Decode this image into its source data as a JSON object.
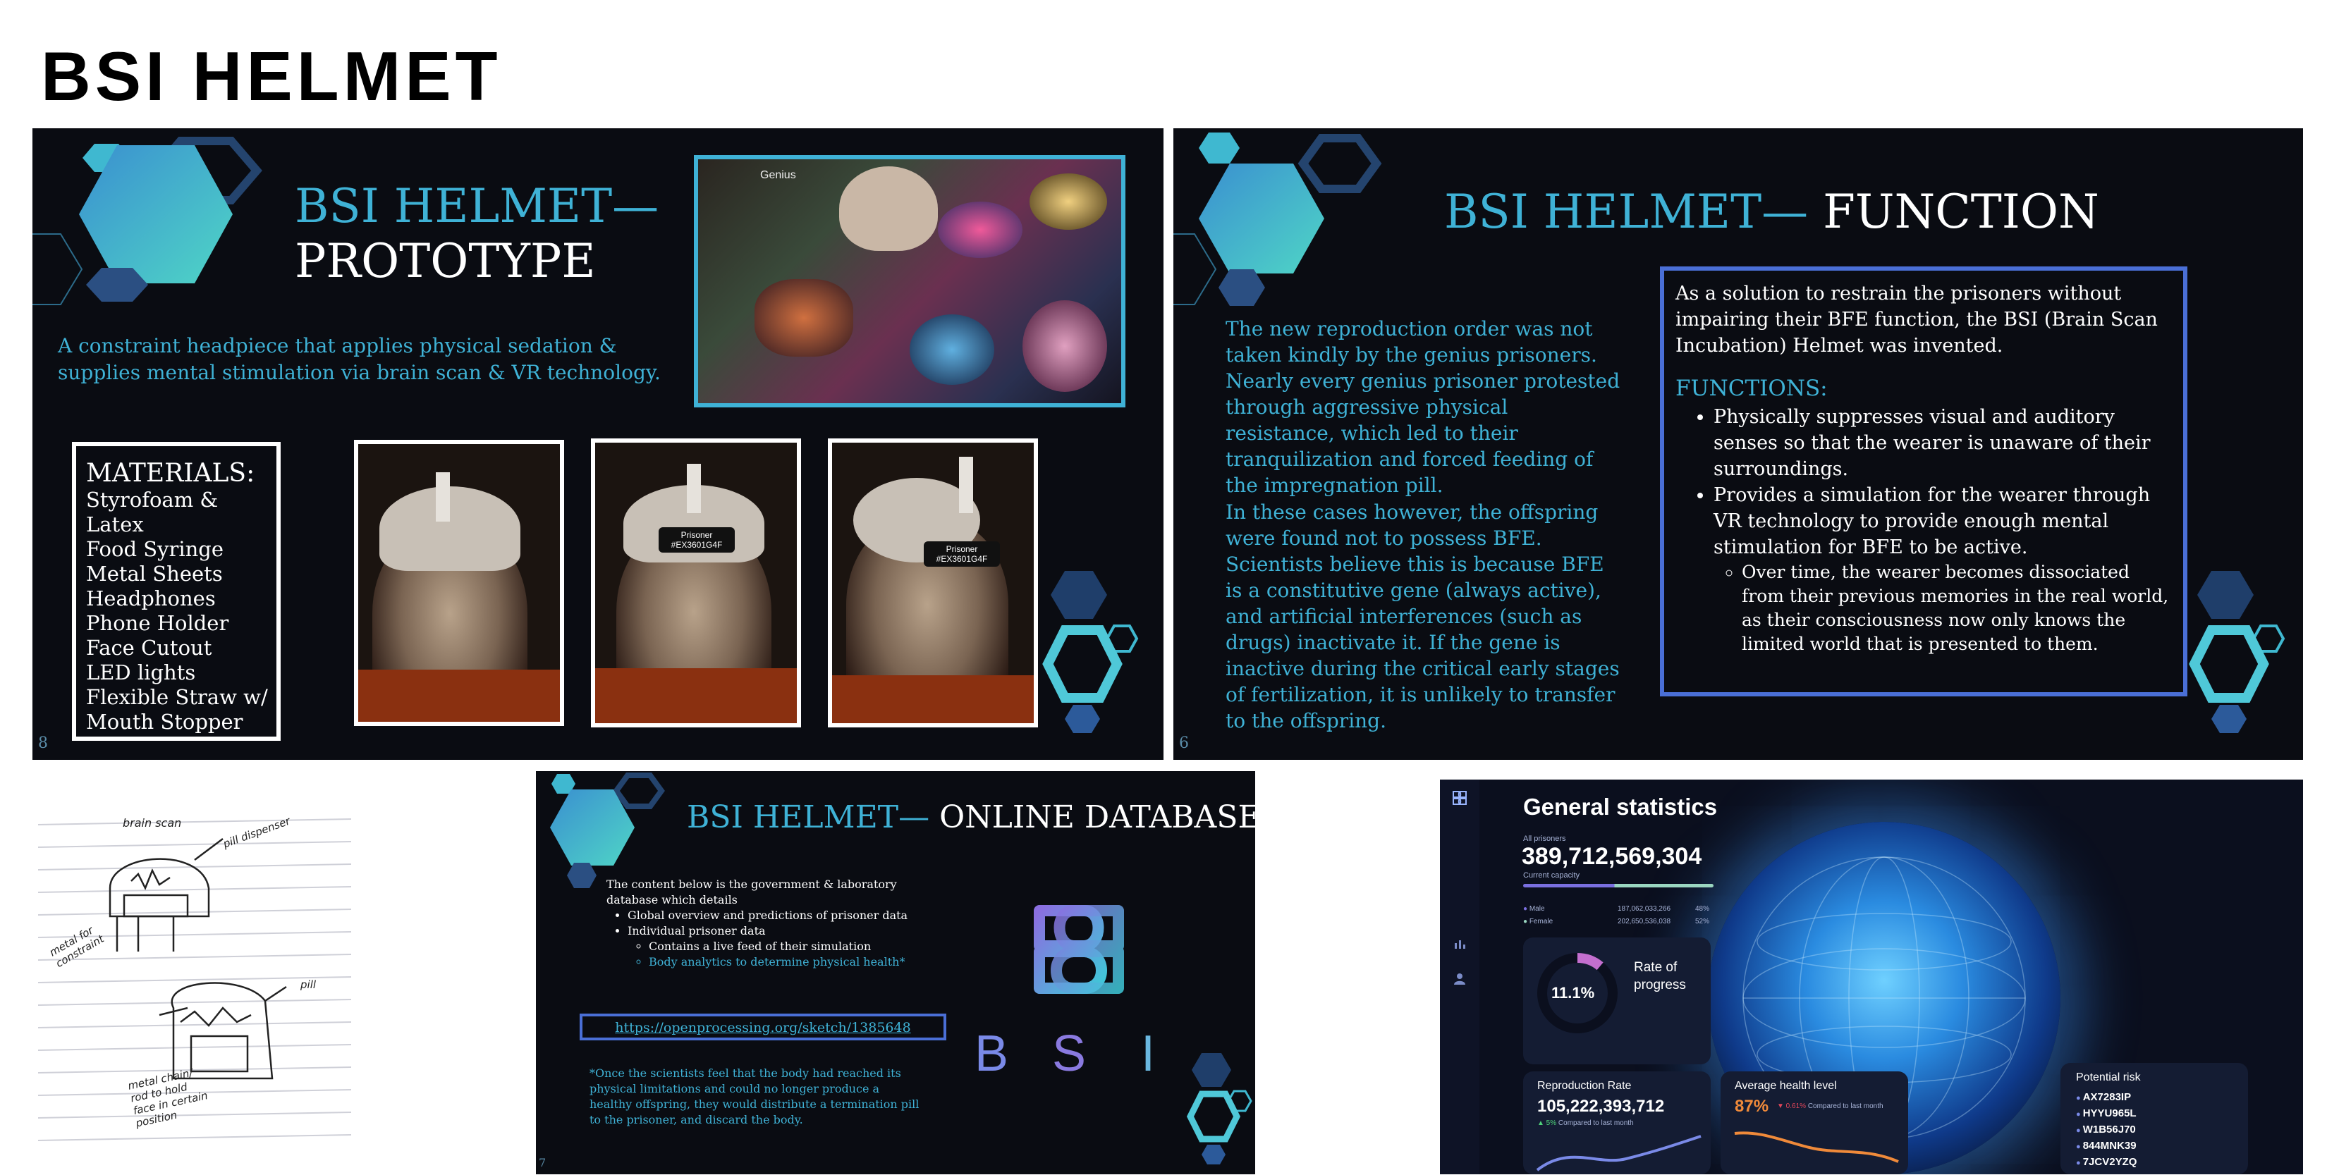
{
  "page_title": "BSI HELMET",
  "slide_prototype": {
    "title_line1": "BSI HELMET—",
    "title_line2": "PROTOTYPE",
    "description": "A constraint headpiece that applies physical sedation & supplies mental stimulation via brain scan & VR technology.",
    "collage_caption": "Genius",
    "materials_heading": "MATERIALS:",
    "materials": [
      "Styrofoam & Latex",
      "Food Syringe",
      "Metal Sheets",
      "Headphones",
      "Phone Holder",
      "Face Cutout",
      "LED lights",
      "Flexible Straw w/",
      "Mouth Stopper"
    ],
    "photo_labels": [
      "",
      "Prisoner\n#EX3601G4F",
      "Prisoner\n#EX3601G4F"
    ],
    "slide_number": "8"
  },
  "slide_function": {
    "title_part1": "BSI HELMET— ",
    "title_part2": "FUNCTION",
    "para1": "The new reproduction order was not taken kindly by the genius prisoners. Nearly every genius prisoner protested through aggressive physical resistance, which led to their tranquilization and forced feeding of the impregnation pill.",
    "para2": "In these cases however, the offspring were found not to possess BFE. Scientists believe this is because BFE is a constitutive gene (always active), and artificial interferences (such as drugs) inactivate it. If the gene is inactive during the critical early stages of fertilization, it is unlikely to transfer to the offspring.",
    "box_intro": "As a solution to restrain the prisoners without impairing their BFE function, the BSI (Brain Scan Incubation) Helmet was invented.",
    "functions_heading": "FUNCTIONS:",
    "bullet1": "Physically suppresses visual and auditory senses so that the wearer is unaware of their surroundings.",
    "bullet2": "Provides a simulation for the wearer through VR technology to provide enough mental stimulation for BFE to be active.",
    "sub_bullet": "Over time, the wearer becomes dissociated from their previous memories in the real world, as their consciousness now only knows the limited world that is presented to them.",
    "slide_number": "6"
  },
  "sketch": {
    "labels": [
      "brain scan",
      "pill dispenser",
      "metal for constraint",
      "pill",
      "metal chain/ rod to hold face in certain position"
    ]
  },
  "slide_database": {
    "title_part1": "BSI HELMET— ",
    "title_part2": "ONLINE DATABASE",
    "intro": "The content below is the government & laboratory database which details",
    "bullet1": "Global overview and predictions of prisoner data",
    "bullet2": "Individual prisoner data",
    "sub1": "Contains a live feed of their simulation",
    "sub2": "Body analytics to determine physical health*",
    "link": "https://openprocessing.org/sketch/1385648",
    "footnote": "*Once the scientists feel that the body had reached its physical limitations and could no longer produce a healthy offspring, they would distribute a termination pill to the prisoner, and discard the body.",
    "logo_letters": [
      "B",
      "S",
      "I"
    ],
    "slide_number": "7"
  },
  "dashboard": {
    "heading": "General statistics",
    "all_prisoners_label": "All prisoners",
    "all_prisoners_value": "389,712,569,304",
    "capacity_label": "Current capacity",
    "male_label": "Male",
    "male_value": "187,062,033,266",
    "male_pct": "48%",
    "female_label": "Female",
    "female_value": "202,650,536,038",
    "female_pct": "52%",
    "progress_value": "11.1%",
    "progress_fraction": 0.111,
    "progress_label": "Rate of progress",
    "reproduction_label": "Reproduction Rate",
    "reproduction_value": "105,222,393,712",
    "reproduction_change": "▲ 5%",
    "reproduction_note": "Compared to last month",
    "health_label": "Average health level",
    "health_value": "87%",
    "health_change": "▼ 0.61%",
    "health_note": "Compared to last month",
    "risk_label": "Potential risk",
    "risk_ids": [
      "AX7283IP",
      "HYYU965L",
      "W1B56J70",
      "844MNK39",
      "7JCV2YZQ"
    ],
    "colors": {
      "accent": "#3fb2d6",
      "progress": "#c46fcf",
      "orange": "#f08a3a",
      "green": "#4fd27a",
      "red": "#e0465a",
      "bg": "#0b0f1e"
    }
  }
}
